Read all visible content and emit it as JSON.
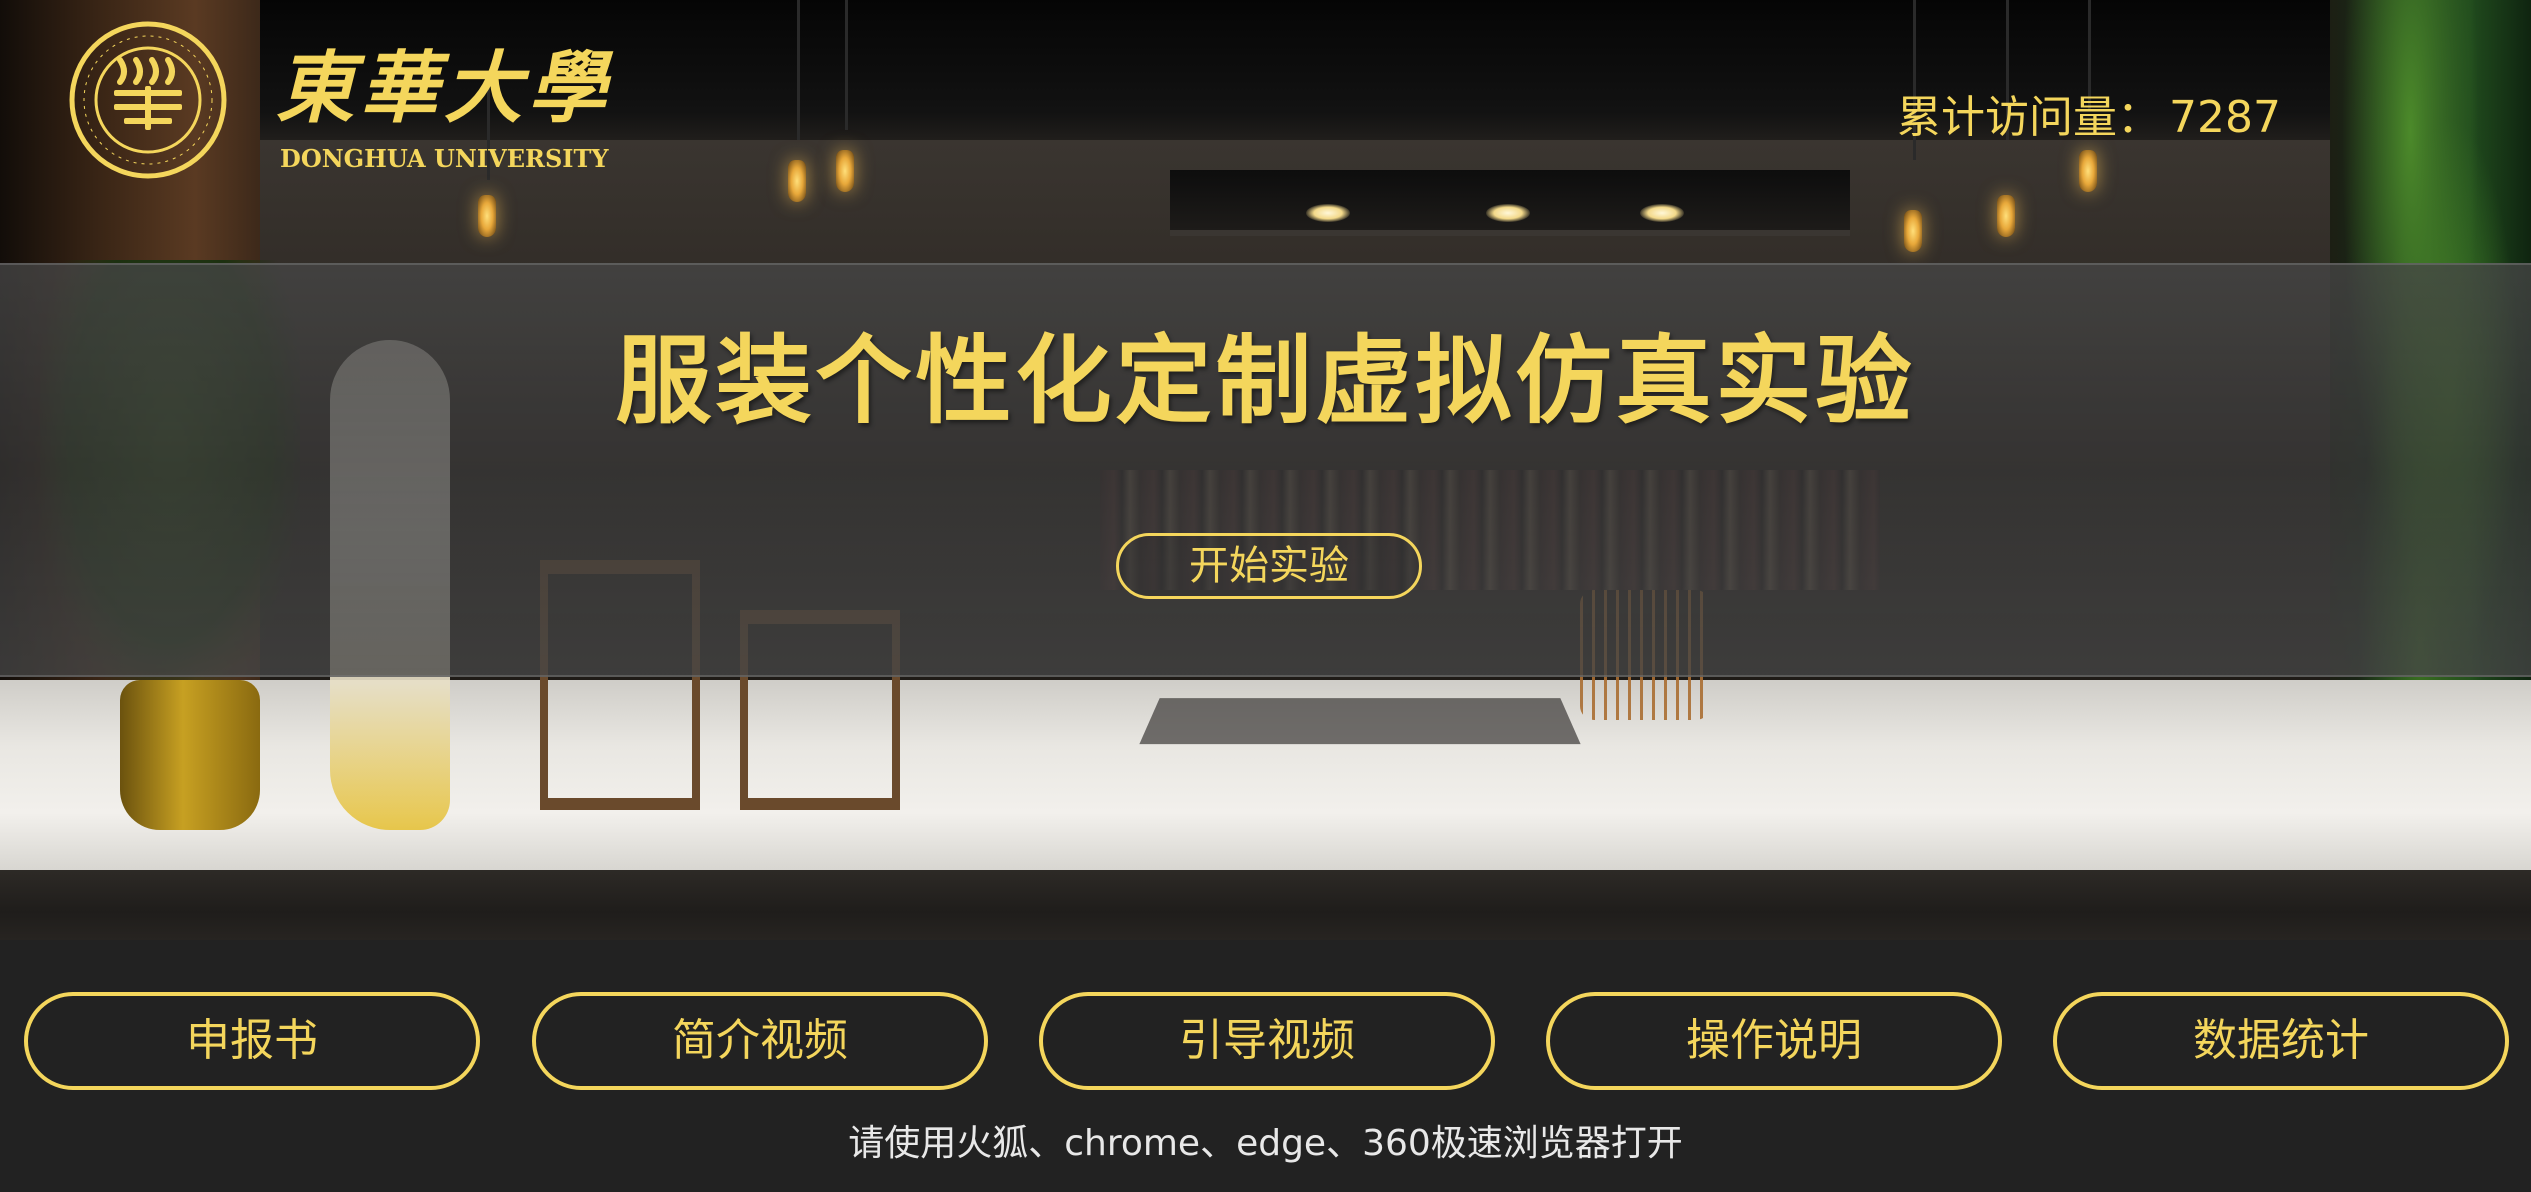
{
  "brand": {
    "name_cn": "東華大學",
    "name_en": "DONGHUA UNIVERSITY"
  },
  "visits": {
    "label": "累计访问量：",
    "value": "7287"
  },
  "hero": {
    "title": "服装个性化定制虚拟仿真实验",
    "start_label": "开始实验"
  },
  "nav": {
    "items": [
      {
        "label": "申报书"
      },
      {
        "label": "简介视频"
      },
      {
        "label": "引导视频"
      },
      {
        "label": "操作说明"
      },
      {
        "label": "数据统计"
      }
    ]
  },
  "footer": {
    "browser_note": "请使用火狐、chrome、edge、360极速浏览器打开"
  },
  "colors": {
    "accent": "#f4d65c",
    "background": "#222222",
    "band": "#464646",
    "note_text": "#e8e8e8"
  },
  "icons": {
    "logo": "donghua-university-seal-icon"
  }
}
